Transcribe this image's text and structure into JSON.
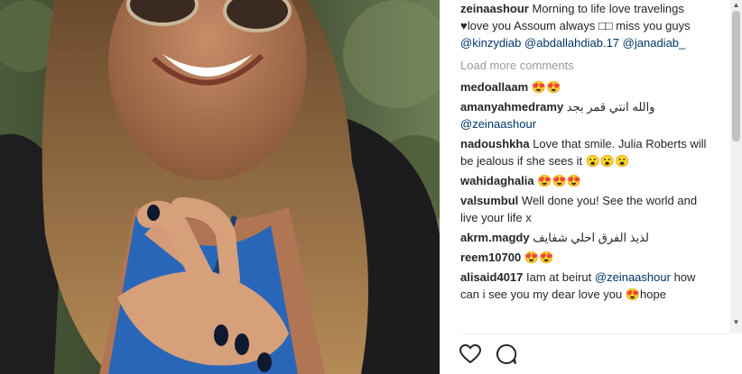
{
  "post": {
    "caption": {
      "username": "zeinaashour",
      "text": "Morning to life love travelings ♥love you Assoum always □□ miss you guys ",
      "mentions": [
        "@kinzydiab",
        "@abdallahdiab.17",
        "@janadiab_"
      ]
    },
    "load_more_label": "Load more comments",
    "comments": [
      {
        "username": "medoallaam",
        "text": "😍😍",
        "mention": ""
      },
      {
        "username": "amanyahmedramy",
        "text": "والله انتي قمر بجد",
        "mention": "@zeinaashour"
      },
      {
        "username": "nadoushkha",
        "text": "Love that smile. Julia Roberts will be jealous if she sees it 😮😮😮",
        "mention": ""
      },
      {
        "username": "wahidaghalia",
        "text": "😍😍😍",
        "mention": ""
      },
      {
        "username": "valsumbul",
        "text": "Well done you! See the world and live your life x",
        "mention": ""
      },
      {
        "username": "akrm.magdy",
        "text": "لذيذ الفرق احلي شفايف",
        "mention": ""
      },
      {
        "username": "reem10700",
        "text": "😍😍",
        "mention": ""
      },
      {
        "username": "alisaid4017",
        "text": "Iam at beirut",
        "mention": "@zeinaashour",
        "tail": "how can i see you my dear love you 😍hope"
      }
    ],
    "actions": {
      "like_icon": "heart-icon",
      "comment_icon": "comment-bubble-icon"
    }
  }
}
